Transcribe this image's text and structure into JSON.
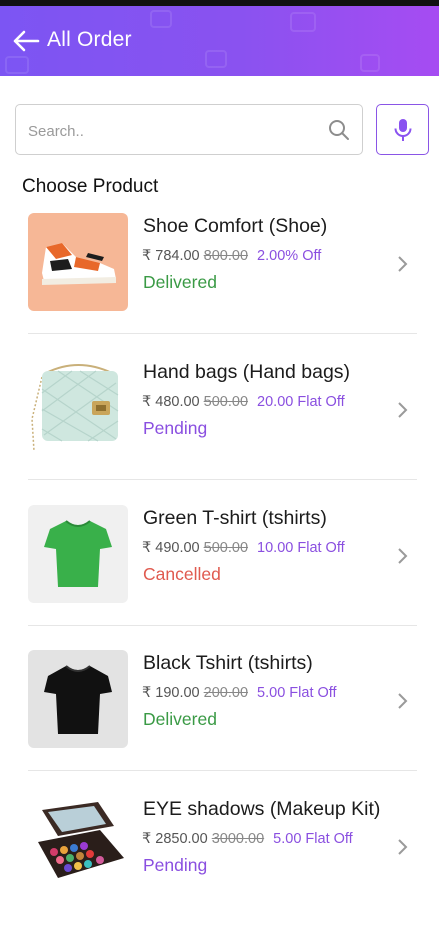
{
  "header": {
    "title": "All Order"
  },
  "search": {
    "placeholder": "Search.."
  },
  "section_title": "Choose Product",
  "currency_symbol": "₹",
  "colors": {
    "accent": "#8a52f0",
    "delivered": "#3a9a45",
    "pending": "#8a4fe0",
    "cancelled": "#e05a4f"
  },
  "products": [
    {
      "name": "Shoe Comfort (Shoe)",
      "price": "784.00",
      "mrp": "800.00",
      "discount": "2.00% Off",
      "status": "Delivered",
      "image": "sneaker-image"
    },
    {
      "name": "Hand bags (Hand bags)",
      "price": "480.00",
      "mrp": "500.00",
      "discount": "20.00 Flat Off",
      "status": "Pending",
      "image": "handbag-image"
    },
    {
      "name": "Green T-shirt (tshirts)",
      "price": "490.00",
      "mrp": "500.00",
      "discount": "10.00 Flat Off",
      "status": "Cancelled",
      "image": "green-tshirt-image"
    },
    {
      "name": "Black Tshirt (tshirts)",
      "price": "190.00",
      "mrp": "200.00",
      "discount": "5.00 Flat Off",
      "status": "Delivered",
      "image": "black-tshirt-image"
    },
    {
      "name": "EYE shadows (Makeup Kit)",
      "price": "2850.00",
      "mrp": "3000.00",
      "discount": "5.00 Flat Off",
      "status": "Pending",
      "image": "makeup-kit-image"
    }
  ]
}
